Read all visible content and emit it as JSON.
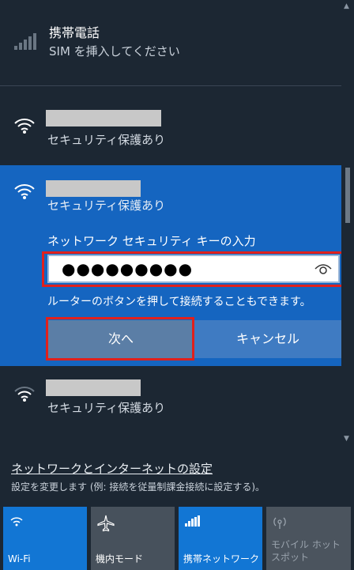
{
  "cellular": {
    "name": "携帯電話",
    "status": "SIM を挿入してください"
  },
  "wifi_networks": [
    {
      "security": "セキュリティ保護あり"
    },
    {
      "security": "セキュリティ保護あり"
    },
    {
      "security": "セキュリティ保護あり"
    }
  ],
  "connect_form": {
    "key_label": "ネットワーク セキュリティ キーの入力",
    "key_value": "●●●●●●●●●",
    "hint": "ルーターのボタンを押して接続することもできます。",
    "next_label": "次へ",
    "cancel_label": "キャンセル"
  },
  "settings": {
    "link": "ネットワークとインターネットの設定",
    "description": "設定を変更します (例: 接続を従量制課金接続に設定する)。"
  },
  "tiles": [
    {
      "label": "Wi-Fi",
      "icon": "wifi-icon",
      "active": true
    },
    {
      "label": "機内モード",
      "icon": "airplane-icon",
      "active": false
    },
    {
      "label": "携帯ネットワーク",
      "icon": "cellular-icon",
      "active": true
    },
    {
      "label": "モバイル ホットスポット",
      "icon": "hotspot-icon",
      "active": false
    }
  ],
  "colors": {
    "accent": "#1565c0",
    "tile_active": "#1276d4",
    "highlight": "#e0201c",
    "background": "#1c2733"
  }
}
